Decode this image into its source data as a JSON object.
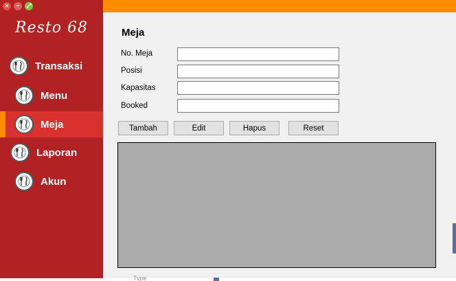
{
  "app": {
    "logo": "Resto 68",
    "window_controls": {
      "close": "×",
      "minimize": "–",
      "maximize": "⤢"
    }
  },
  "sidebar": {
    "items": [
      {
        "label": "Transaksi",
        "icon": "restaurant-icon"
      },
      {
        "label": "Menu",
        "icon": "restaurant-icon"
      },
      {
        "label": "Meja",
        "icon": "restaurant-icon",
        "active": true
      },
      {
        "label": "Laporan",
        "icon": "restaurant-icon"
      },
      {
        "label": "Akun",
        "icon": "restaurant-icon"
      }
    ]
  },
  "main": {
    "title": "Meja",
    "fields": [
      {
        "label": "No. Meja",
        "value": ""
      },
      {
        "label": "Posisi",
        "value": ""
      },
      {
        "label": "Kapasitas",
        "value": ""
      },
      {
        "label": "Booked",
        "value": ""
      }
    ],
    "buttons": {
      "add": "Tambah",
      "edit": "Edit",
      "delete": "Hapus",
      "reset": "Reset"
    }
  },
  "background_window": {
    "text": "Type"
  },
  "colors": {
    "sidebar": "#b22222",
    "sidebar_active": "#d9312d",
    "accent": "#ff8c00",
    "grid": "#ababab"
  }
}
